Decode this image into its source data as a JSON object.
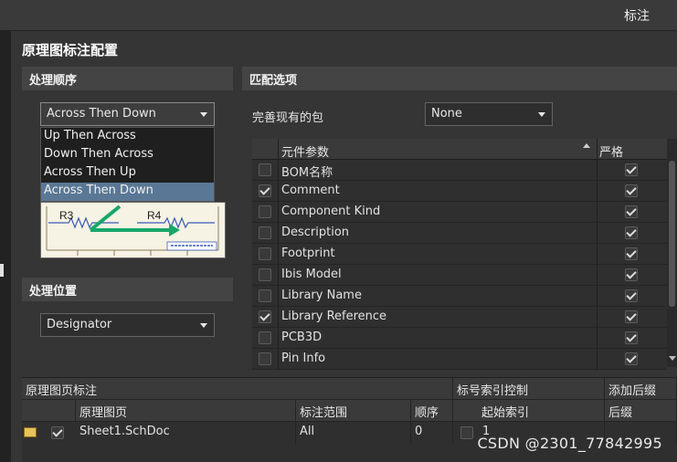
{
  "window": {
    "title": "标注"
  },
  "dialog": {
    "title": "原理图标注配置"
  },
  "order_section": {
    "heading": "处理顺序",
    "selected": "Across Then Down",
    "options": [
      "Up Then Across",
      "Down Then Across",
      "Across Then Up",
      "Across Then Down"
    ],
    "preview_labels": [
      "R3",
      "R4"
    ]
  },
  "position_section": {
    "heading": "处理位置",
    "selected": "Designator"
  },
  "match_section": {
    "heading": "匹配选项",
    "complete_label": "完善现有的包",
    "complete_value": "None",
    "columns": {
      "param": "元件参数",
      "strict": "严格"
    },
    "rows": [
      {
        "name": "BOM名称",
        "checked": false,
        "strict": true
      },
      {
        "name": "Comment",
        "checked": true,
        "strict": true
      },
      {
        "name": "Component Kind",
        "checked": false,
        "strict": true
      },
      {
        "name": "Description",
        "checked": false,
        "strict": true
      },
      {
        "name": "Footprint",
        "checked": false,
        "strict": true
      },
      {
        "name": "Ibis Model",
        "checked": false,
        "strict": true
      },
      {
        "name": "Library Name",
        "checked": false,
        "strict": true
      },
      {
        "name": "Library Reference",
        "checked": true,
        "strict": true
      },
      {
        "name": "PCB3D",
        "checked": false,
        "strict": true
      },
      {
        "name": "Pin Info",
        "checked": false,
        "strict": true
      }
    ]
  },
  "sheets_section": {
    "group_headers": {
      "sheets": "原理图页标注",
      "index": "标号索引控制",
      "suffix": "添加后缀"
    },
    "columns": {
      "sheet": "原理图页",
      "scope": "标注范围",
      "order": "顺序",
      "start": "起始索引",
      "suffix": "后缀"
    },
    "rows": [
      {
        "sheet": "Sheet1.SchDoc",
        "scope": "All",
        "order": "0",
        "start": "1",
        "enabled": true,
        "start_enabled": false
      }
    ]
  },
  "watermark": "CSDN @2301_77842995",
  "colors": {
    "highlight": "#5a7895",
    "arrow": "#18a66a"
  }
}
